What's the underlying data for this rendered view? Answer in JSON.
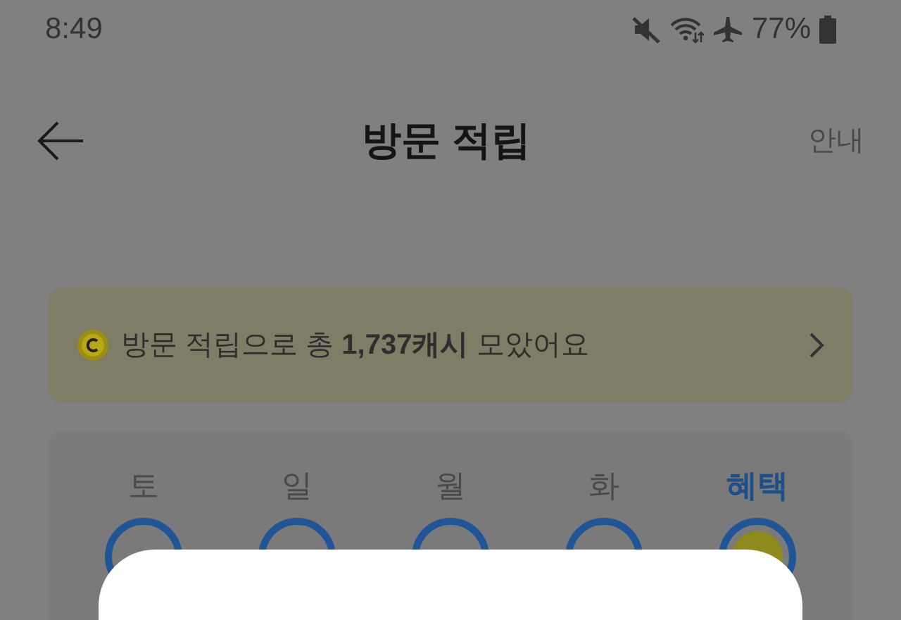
{
  "status_bar": {
    "time": "8:49",
    "battery": "77%"
  },
  "header": {
    "title": "방문 적립",
    "action": "안내"
  },
  "banner": {
    "text": "방문 적립으로 총 **1,737캐시** 모았어요"
  },
  "days": [
    {
      "label": "토",
      "selected": false,
      "kind": "day"
    },
    {
      "label": "일",
      "selected": false,
      "kind": "day"
    },
    {
      "label": "월",
      "selected": false,
      "kind": "day"
    },
    {
      "label": "화",
      "selected": false,
      "kind": "day"
    },
    {
      "label": "혜택",
      "selected": true,
      "kind": "bonus"
    }
  ]
}
